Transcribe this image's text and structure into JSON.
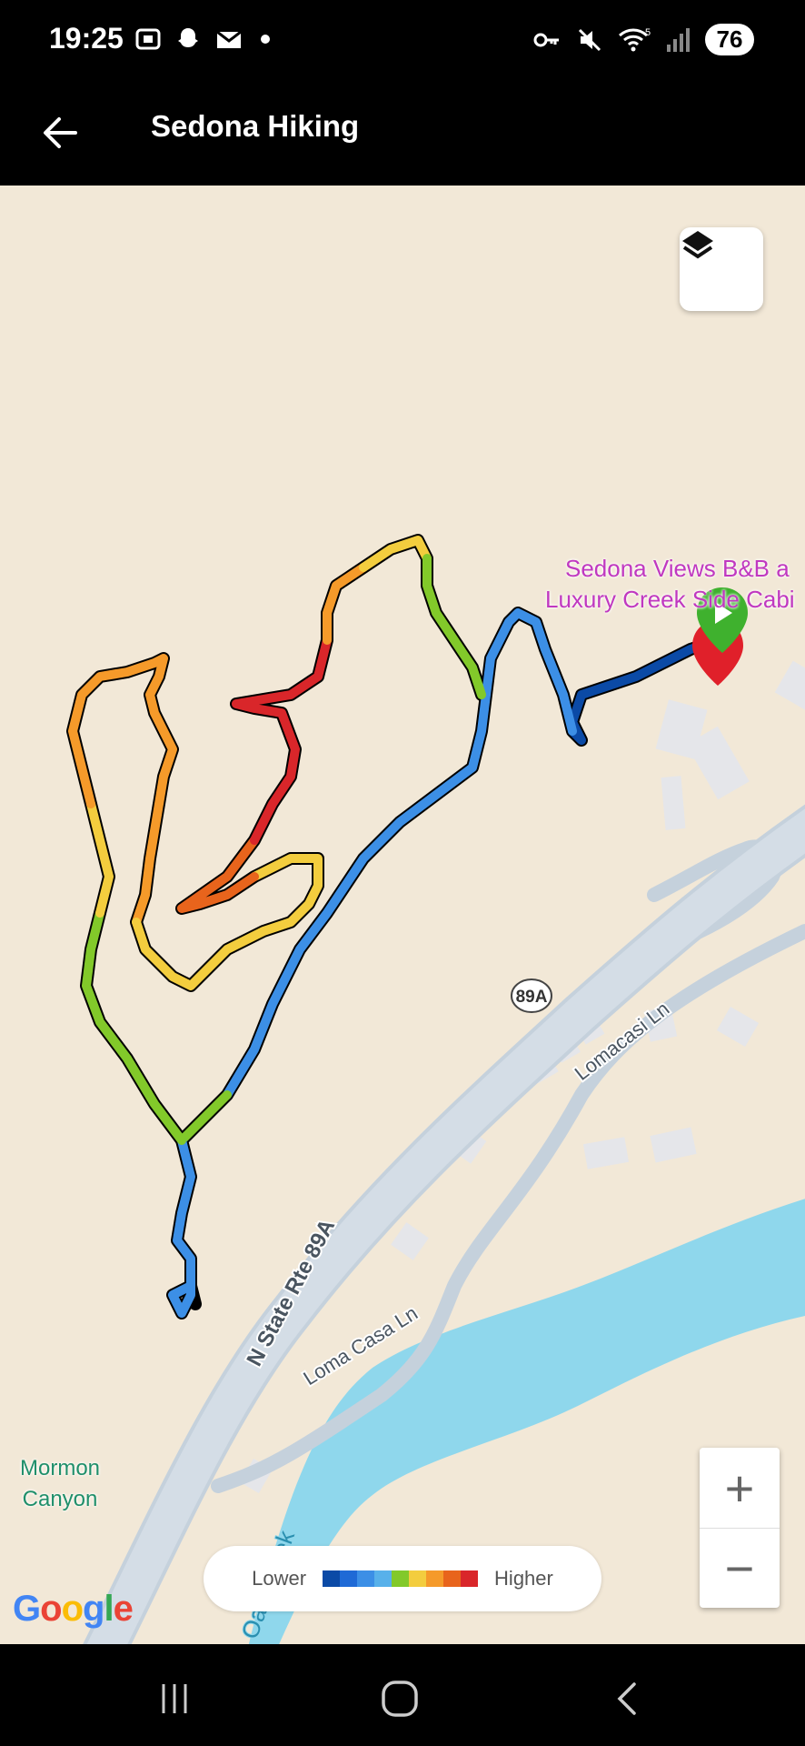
{
  "status_bar": {
    "time": "19:25",
    "battery": "76",
    "wifi_badge": "5",
    "icons_left": [
      "screenshot-icon",
      "snapchat-icon",
      "gmail-icon",
      "dot-icon"
    ],
    "icons_right": [
      "vpn-key-icon",
      "mute-icon",
      "wifi-icon",
      "signal-icon",
      "battery-icon"
    ]
  },
  "app_bar": {
    "title": "Sedona Hiking",
    "back_icon": "arrow-left-icon"
  },
  "map": {
    "place_label_line1": "Sedona Views B&B a",
    "place_label_line2": "Luxury Creek Side Cabi",
    "road_label_main": "N State Rte 89A",
    "highway_shield": "89A",
    "road_label_lomacasi": "Lomacasi Ln",
    "road_label_lomacasa": "Loma Casa Ln",
    "creek_label": "Oak Creek",
    "canyon_label_line1": "Mormon",
    "canyon_label_line2": "Canyon",
    "attribution": "Google",
    "colors": {
      "background": "#f2e8d7",
      "road": "#c5d1dc",
      "water": "#8fd7ec",
      "building": "#e5e6ea"
    }
  },
  "controls": {
    "layers_icon": "layers-icon",
    "zoom_in_label": "+",
    "zoom_out_label": "−"
  },
  "legend": {
    "lower_label": "Lower",
    "higher_label": "Higher",
    "colors": [
      "#0b4aa6",
      "#1f6ad6",
      "#3c8fe6",
      "#58b1ea",
      "#82c92a",
      "#f3cd3e",
      "#f59a2a",
      "#e8641c",
      "#d9262a"
    ]
  },
  "nav_bar": {
    "recent_icon": "recent-apps-icon",
    "home_icon": "home-icon",
    "back_icon": "nav-back-icon"
  }
}
